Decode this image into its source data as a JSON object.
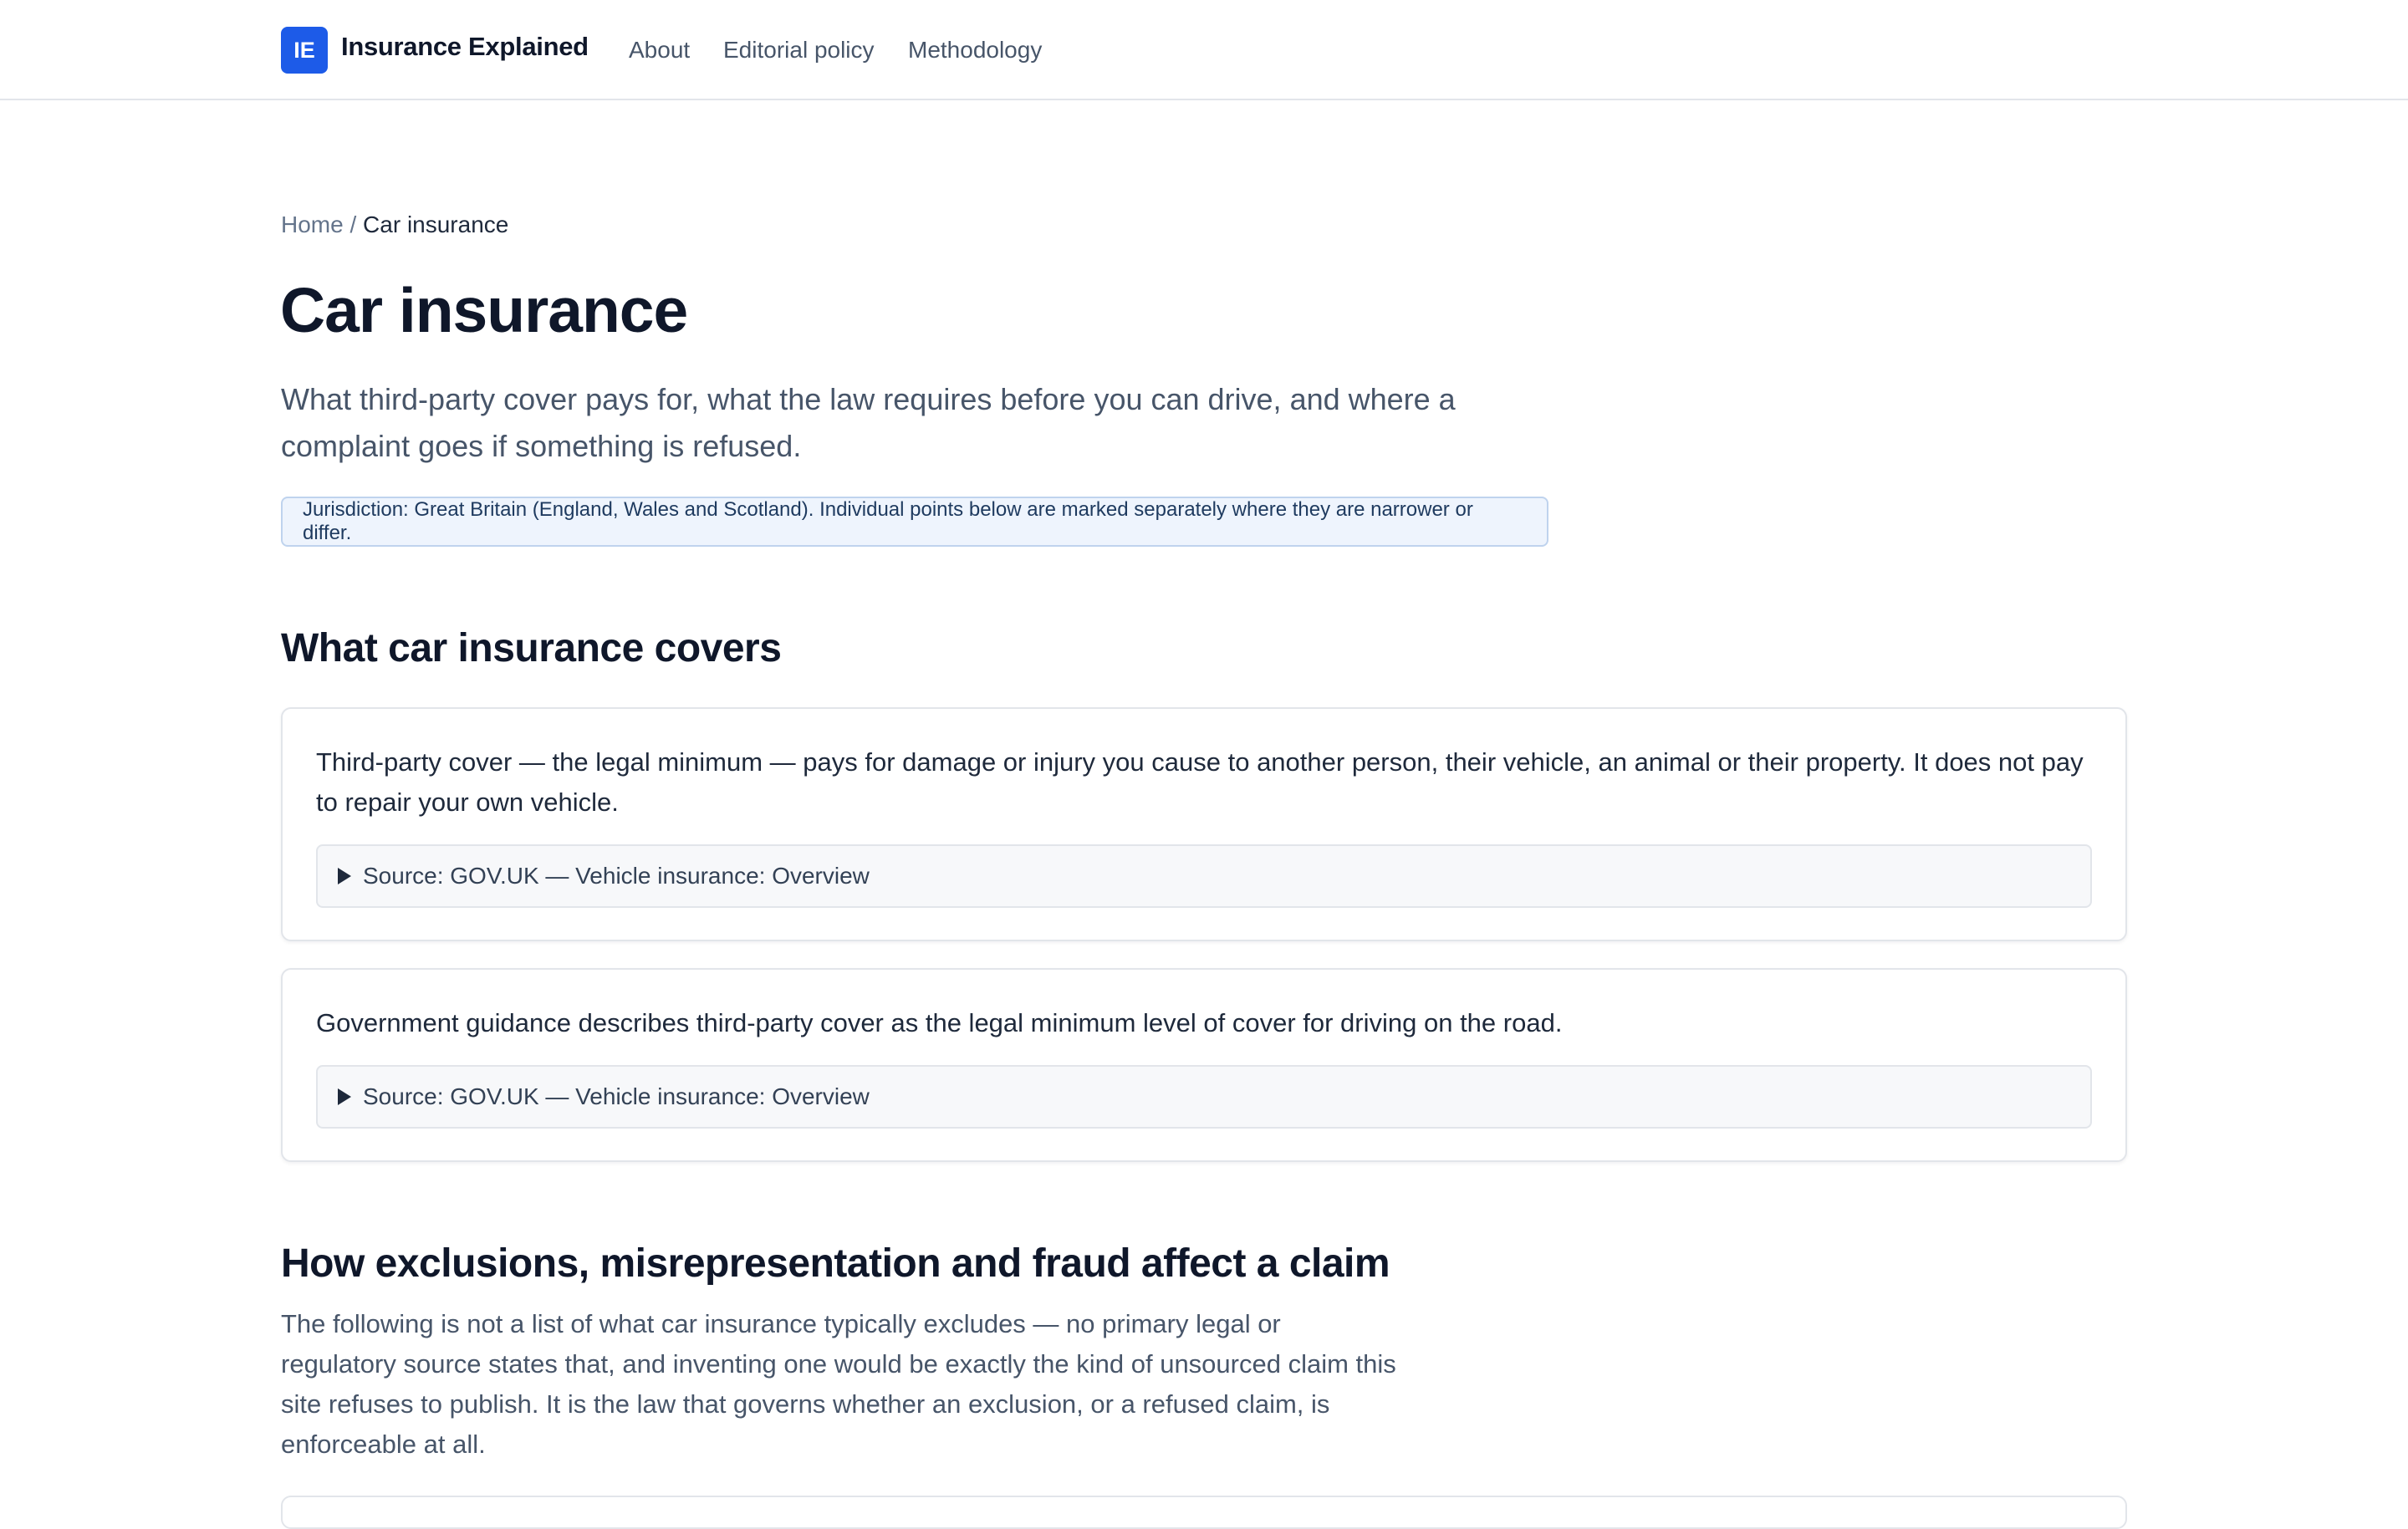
{
  "header": {
    "logo_text": "IE",
    "site_name": "Insurance Explained",
    "nav": [
      {
        "label": "About"
      },
      {
        "label": "Editorial policy"
      },
      {
        "label": "Methodology"
      }
    ]
  },
  "breadcrumb": {
    "home": "Home",
    "separator": "/",
    "current": "Car insurance"
  },
  "page": {
    "title": "Car insurance",
    "lede": "What third-party cover pays for, what the law requires before you can drive, and where a complaint goes if something is refused.",
    "jurisdiction": "Jurisdiction: Great Britain (England, Wales and Scotland). Individual points below are marked separately where they are narrower or differ."
  },
  "sections": [
    {
      "heading": "What car insurance covers",
      "cards": [
        {
          "text": "Third-party cover — the legal minimum — pays for damage or injury you cause to another person, their vehicle, an animal or their property. It does not pay to repair your own vehicle.",
          "source_label": "Source: GOV.UK — Vehicle insurance: Overview"
        },
        {
          "text": "Government guidance describes third-party cover as the legal minimum level of cover for driving on the road.",
          "source_label": "Source: GOV.UK — Vehicle insurance: Overview"
        }
      ]
    },
    {
      "heading": "How exclusions, misrepresentation and fraud affect a claim",
      "intro": "The following is not a list of what car insurance typically excludes — no primary legal or regulatory source states that, and inventing one would be exactly the kind of unsourced claim this site refuses to publish. It is the law that governs whether an exclusion, or a refused claim, is enforceable at all."
    }
  ],
  "colors": {
    "accent": "#1d5be8",
    "jurisdiction_bg": "#eef4fd",
    "jurisdiction_border": "#bfd3ee"
  }
}
